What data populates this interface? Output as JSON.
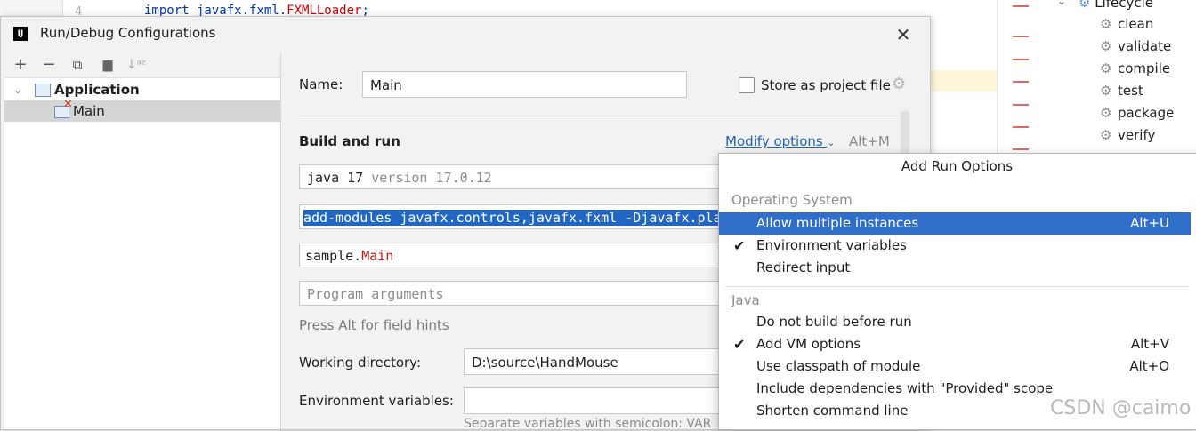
{
  "editor": {
    "line_number": "4",
    "code_prefix": "import javafx.fxml.",
    "code_class": "FXMLLoader",
    "code_suffix": ";"
  },
  "maven": {
    "lifecycle_label": "Lifecycle",
    "items": [
      "clean",
      "validate",
      "compile",
      "test",
      "package",
      "verify"
    ]
  },
  "dialog": {
    "title": "Run/Debug Configurations",
    "app_logo_text": "IJ",
    "close_glyph": "✕"
  },
  "tree": {
    "toolbar": {
      "add": "+",
      "remove": "−",
      "copy": "⧉",
      "folder": "▆",
      "sort": "↓ᵃᶻ"
    },
    "application_label": "Application",
    "main_label": "Main"
  },
  "form": {
    "name_label": "Name:",
    "name_value": "Main",
    "store_label": "Store as project file",
    "section_title": "Build and run",
    "modify_options_label": "Modify options",
    "modify_options_shortcut": "Alt+M",
    "jdk_name": "java 17",
    "jdk_version": "version 17.0.12",
    "vm_options_value": "add-modules javafx.controls,javafx.fxml -Djavafx.pla",
    "main_class_prefix": "sample.",
    "main_class_name": "Main",
    "program_args_placeholder": "Program arguments",
    "field_hints_text": "Press Alt for field hints",
    "working_dir_label": "Working directory:",
    "working_dir_value": "D:\\source\\HandMouse",
    "env_vars_label": "Environment variables:",
    "env_vars_hint": "Separate variables with semicolon: VAR"
  },
  "popup": {
    "title": "Add Run Options",
    "groups": [
      {
        "name": "Operating System",
        "items": [
          {
            "label": "Allow multiple instances",
            "shortcut": "Alt+U",
            "checked": false,
            "active": true
          },
          {
            "label": "Environment variables",
            "shortcut": "",
            "checked": true,
            "active": false
          },
          {
            "label": "Redirect input",
            "shortcut": "",
            "checked": false,
            "active": false
          }
        ]
      },
      {
        "name": "Java",
        "items": [
          {
            "label": "Do not build before run",
            "shortcut": "",
            "checked": false,
            "active": false
          },
          {
            "label": "Add VM options",
            "shortcut": "Alt+V",
            "checked": true,
            "active": false
          },
          {
            "label": "Use classpath of module",
            "shortcut": "Alt+O",
            "checked": false,
            "active": false
          },
          {
            "label": "Include dependencies with \"Provided\" scope",
            "shortcut": "",
            "checked": false,
            "active": false
          },
          {
            "label": "Shorten command line",
            "shortcut": "",
            "checked": false,
            "active": false
          }
        ]
      }
    ],
    "check_glyph": "✔"
  },
  "watermark": "CSDN @caimo",
  "colors": {
    "accent": "#2f6fc9",
    "selection": "#2266c4",
    "keyword": "#c41a16"
  }
}
